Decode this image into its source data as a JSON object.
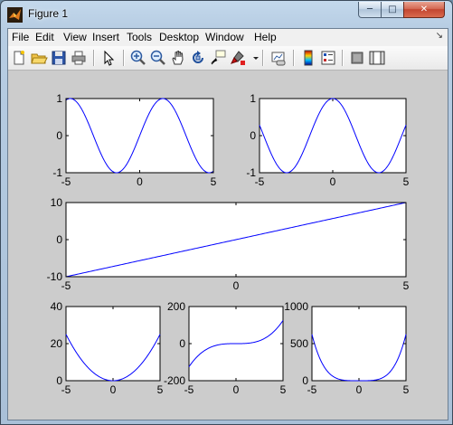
{
  "window": {
    "title": "Figure 1",
    "minimize_glyph": "─",
    "maximize_glyph": "□",
    "close_glyph": "✕"
  },
  "menubar": {
    "items": [
      "File",
      "Edit",
      "View",
      "Insert",
      "Tools",
      "Desktop",
      "Window",
      "Help"
    ],
    "dock_arrow": "↘"
  },
  "toolbar": {
    "tools": [
      {
        "name": "new-figure-icon"
      },
      {
        "name": "open-file-icon"
      },
      {
        "name": "save-figure-icon"
      },
      {
        "name": "print-figure-icon"
      },
      {
        "name": "edit-plot-arrow-icon"
      },
      {
        "name": "zoom-in-icon"
      },
      {
        "name": "zoom-out-icon"
      },
      {
        "name": "pan-hand-icon"
      },
      {
        "name": "rotate-3d-icon"
      },
      {
        "name": "data-cursor-icon"
      },
      {
        "name": "brush-data-icon"
      },
      {
        "name": "brush-dropdown-icon"
      },
      {
        "name": "link-plot-icon"
      },
      {
        "name": "insert-colorbar-icon"
      },
      {
        "name": "insert-legend-icon"
      },
      {
        "name": "hide-plot-tools-icon"
      },
      {
        "name": "show-plot-tools-icon"
      }
    ]
  },
  "chart_data": [
    {
      "type": "line",
      "function": "sin(x)",
      "x_range": [
        -5,
        5
      ],
      "xlim": [
        -5,
        5
      ],
      "ylim": [
        -1,
        1
      ],
      "xticks": [
        "-5",
        "0",
        "5"
      ],
      "yticks": [
        "-1",
        "0",
        "1"
      ],
      "title": "",
      "xlabel": "",
      "ylabel": "",
      "grid": false,
      "series_color": "#0000ff",
      "x": [
        -5,
        -4.5,
        -4,
        -3.5,
        -3,
        -2.5,
        -2,
        -1.5,
        -1,
        -0.5,
        0,
        0.5,
        1,
        1.5,
        2,
        2.5,
        3,
        3.5,
        4,
        4.5,
        5
      ],
      "y": [
        0.959,
        0.978,
        0.757,
        0.351,
        -0.141,
        -0.598,
        -0.909,
        -0.997,
        -0.841,
        -0.479,
        0,
        0.479,
        0.841,
        0.997,
        0.909,
        0.598,
        0.141,
        -0.351,
        -0.757,
        -0.978,
        -0.959
      ]
    },
    {
      "type": "line",
      "function": "cos(x)",
      "x_range": [
        -5,
        5
      ],
      "xlim": [
        -5,
        5
      ],
      "ylim": [
        -1,
        1
      ],
      "xticks": [
        "-5",
        "0",
        "5"
      ],
      "yticks": [
        "-1",
        "0",
        "1"
      ],
      "title": "",
      "xlabel": "",
      "ylabel": "",
      "grid": false,
      "series_color": "#0000ff",
      "x": [
        -5,
        -4.5,
        -4,
        -3.5,
        -3,
        -2.5,
        -2,
        -1.5,
        -1,
        -0.5,
        0,
        0.5,
        1,
        1.5,
        2,
        2.5,
        3,
        3.5,
        4,
        4.5,
        5
      ],
      "y": [
        0.284,
        -0.211,
        -0.654,
        -0.936,
        -0.99,
        -0.801,
        -0.416,
        0.071,
        0.54,
        0.878,
        1,
        0.878,
        0.54,
        0.071,
        -0.416,
        -0.801,
        -0.99,
        -0.936,
        -0.654,
        -0.211,
        0.284
      ]
    },
    {
      "type": "line",
      "function": "2x",
      "x_range": [
        -5,
        5
      ],
      "xlim": [
        -5,
        5
      ],
      "ylim": [
        -10,
        10
      ],
      "xticks": [
        "-5",
        "0",
        "5"
      ],
      "yticks": [
        "-10",
        "0",
        "10"
      ],
      "title": "",
      "xlabel": "",
      "ylabel": "",
      "grid": false,
      "series_color": "#0000ff",
      "x": [
        -5,
        0,
        5
      ],
      "y": [
        -10,
        0,
        10
      ]
    },
    {
      "type": "line",
      "function": "x^2",
      "x_range": [
        -5,
        5
      ],
      "xlim": [
        -5,
        5
      ],
      "ylim": [
        0,
        40
      ],
      "xticks": [
        "-5",
        "0",
        "5"
      ],
      "yticks": [
        "0",
        "20",
        "40"
      ],
      "title": "",
      "xlabel": "",
      "ylabel": "",
      "grid": false,
      "series_color": "#0000ff",
      "x": [
        -5,
        -4,
        -3,
        -2,
        -1,
        0,
        1,
        2,
        3,
        4,
        5
      ],
      "y": [
        25,
        16,
        9,
        4,
        1,
        0,
        1,
        4,
        9,
        16,
        25
      ]
    },
    {
      "type": "line",
      "function": "x^3",
      "x_range": [
        -5,
        5
      ],
      "xlim": [
        -5,
        5
      ],
      "ylim": [
        -200,
        200
      ],
      "xticks": [
        "-5",
        "0",
        "5"
      ],
      "yticks": [
        "-200",
        "0",
        "200"
      ],
      "title": "",
      "xlabel": "",
      "ylabel": "",
      "grid": false,
      "series_color": "#0000ff",
      "x": [
        -5,
        -4,
        -3,
        -2,
        -1,
        0,
        1,
        2,
        3,
        4,
        5
      ],
      "y": [
        -125,
        -64,
        -27,
        -8,
        -1,
        0,
        1,
        8,
        27,
        64,
        125
      ]
    },
    {
      "type": "line",
      "function": "x^4",
      "x_range": [
        -5,
        5
      ],
      "xlim": [
        -5,
        5
      ],
      "ylim": [
        0,
        1000
      ],
      "xticks": [
        "-5",
        "0",
        "5"
      ],
      "yticks": [
        "0",
        "500",
        "1000"
      ],
      "title": "",
      "xlabel": "",
      "ylabel": "",
      "grid": false,
      "series_color": "#0000ff",
      "x": [
        -5,
        -4.5,
        -4,
        -3.5,
        -3,
        -2.5,
        -2,
        -1.5,
        -1,
        -0.5,
        0,
        0.5,
        1,
        1.5,
        2,
        2.5,
        3,
        3.5,
        4,
        4.5,
        5
      ],
      "y": [
        625,
        410,
        256,
        150,
        81,
        39,
        16,
        5.1,
        1,
        0.06,
        0,
        0.06,
        1,
        5.1,
        16,
        39,
        81,
        150,
        256,
        410,
        625
      ]
    }
  ]
}
